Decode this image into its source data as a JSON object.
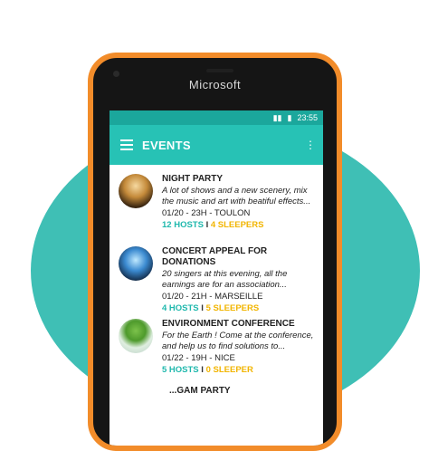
{
  "device": {
    "brand": "Microsoft",
    "frame_color": "#f28c2a",
    "accent_ring": "#3fbfb5"
  },
  "statusbar": {
    "time": "23:55",
    "icons": [
      "signal-icon",
      "battery-icon"
    ]
  },
  "appbar": {
    "title": "EVENTS",
    "color": "#27c2b5"
  },
  "events": [
    {
      "title": "NIGHT PARTY",
      "description": "A lot of shows and a new scenery, mix the music and art with beatiful effects...",
      "meta": "01/20 - 23H - TOULON",
      "hosts": "12 HOSTS",
      "sep": "I",
      "sleepers": "4 SLEEPERS",
      "image": "party-image"
    },
    {
      "title": "CONCERT APPEAL FOR DONATIONS",
      "description": "20 singers at this evening, all the earnings are for an association...",
      "meta": "01/20 - 21H - MARSEILLE",
      "hosts": "4 HOSTS",
      "sep": "I",
      "sleepers": "5 SLEEPERS",
      "image": "concert-image"
    },
    {
      "title": "ENVIRONMENT CONFERENCE",
      "description": "For the Earth ! Come at the conference, and help us to find solutions to...",
      "meta": "01/22 - 19H - NICE",
      "hosts": "5 HOSTS",
      "sep": "I",
      "sleepers": "0 SLEEPER",
      "image": "environment-image"
    }
  ],
  "partial_event": {
    "title": "...GAM PARTY"
  }
}
